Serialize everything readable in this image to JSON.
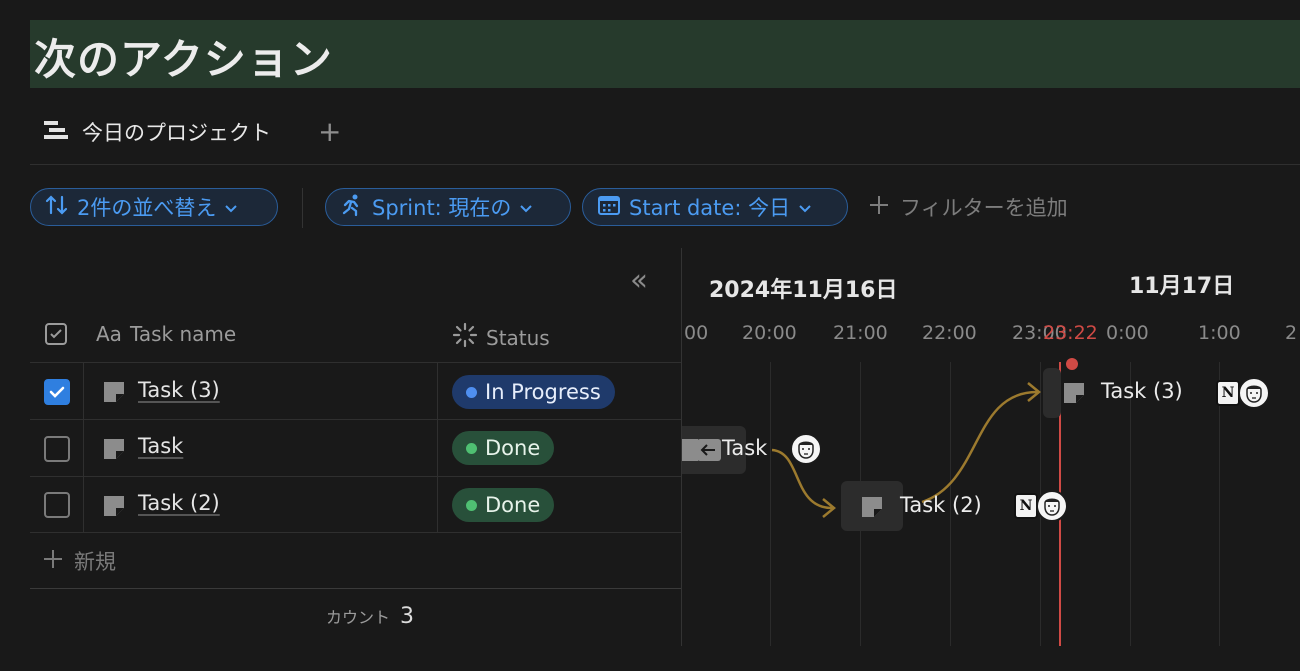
{
  "page": {
    "title": "次のアクション"
  },
  "view": {
    "tab_label": "今日のプロジェクト",
    "add_view_label": "+"
  },
  "filters": {
    "sort_label": "2件の並べ替え",
    "sprint_label": "Sprint: 現在の",
    "start_date_label": "Start date: 今日",
    "add_filter_label": "フィルターを追加"
  },
  "table": {
    "headers": {
      "task_name_prefix": "Aa",
      "task_name": "Task name",
      "status": "Status"
    },
    "rows": [
      {
        "checked": true,
        "name": "Task (3)",
        "status": "In Progress"
      },
      {
        "checked": false,
        "name": "Task",
        "status": "Done"
      },
      {
        "checked": false,
        "name": "Task (2)",
        "status": "Done"
      }
    ],
    "new_label": "新規",
    "count_label": "カウント",
    "count_value": "3"
  },
  "timeline": {
    "date_primary": "2024年11月16日",
    "date_secondary": "11月17日",
    "ticks": [
      "00",
      "20:00",
      "21:00",
      "22:00",
      "23:00",
      "0:00",
      "1:00",
      "2"
    ],
    "now_label": "23:22",
    "items": [
      {
        "label": "Task (3)"
      },
      {
        "label": "Task"
      },
      {
        "label": "Task (2)"
      }
    ]
  },
  "colors": {
    "accent_blue": "#4b9bf2",
    "in_progress_bg": "#1f3a6b",
    "in_progress_dot": "#4f8ff0",
    "done_bg": "#28503a",
    "done_dot": "#4fbf72",
    "now_red": "#d04a45",
    "dependency_arrow": "#9c7a2e",
    "title_bg": "#263a2c"
  },
  "icons": {
    "view_tab": "timeline-view-icon",
    "sort": "sort-arrows-icon",
    "sprint": "running-person-icon",
    "calendar": "calendar-icon",
    "status": "status-spinner-icon",
    "page": "page-icon",
    "avatar": "user-avatar-icon",
    "notion": "notion-logo-icon"
  }
}
